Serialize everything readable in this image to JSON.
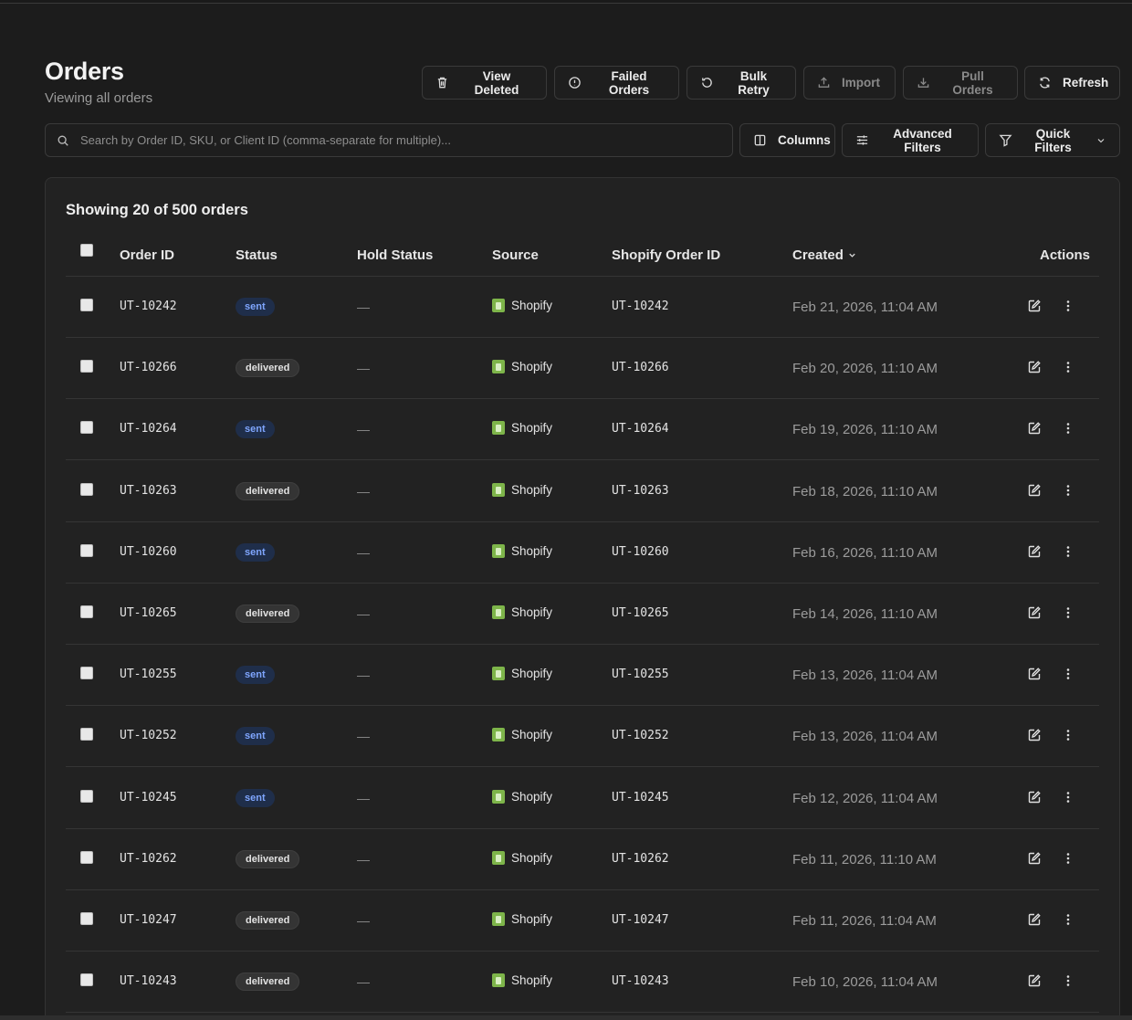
{
  "page": {
    "title": "Orders",
    "subtitle": "Viewing all orders"
  },
  "toolbar": {
    "view_deleted": "View Deleted",
    "failed_orders": "Failed Orders",
    "bulk_retry": "Bulk Retry",
    "import": "Import",
    "pull_orders": "Pull Orders",
    "refresh": "Refresh"
  },
  "search": {
    "placeholder": "Search by Order ID, SKU, or Client ID (comma-separate for multiple)...",
    "value": ""
  },
  "filters": {
    "columns": "Columns",
    "advanced_filters": "Advanced Filters",
    "quick_filters": "Quick Filters"
  },
  "table": {
    "showing": "Showing 20 of 500 orders",
    "headers": {
      "order_id": "Order ID",
      "status": "Status",
      "hold_status": "Hold Status",
      "source": "Source",
      "shopify_order_id": "Shopify Order ID",
      "created": "Created",
      "actions": "Actions"
    },
    "rows": [
      {
        "order_id": "UT-10242",
        "status": "sent",
        "hold": "—",
        "source": "Shopify",
        "shopify_id": "UT-10242",
        "created": "Feb 21, 2026, 11:04 AM"
      },
      {
        "order_id": "UT-10266",
        "status": "delivered",
        "hold": "—",
        "source": "Shopify",
        "shopify_id": "UT-10266",
        "created": "Feb 20, 2026, 11:10 AM"
      },
      {
        "order_id": "UT-10264",
        "status": "sent",
        "hold": "—",
        "source": "Shopify",
        "shopify_id": "UT-10264",
        "created": "Feb 19, 2026, 11:10 AM"
      },
      {
        "order_id": "UT-10263",
        "status": "delivered",
        "hold": "—",
        "source": "Shopify",
        "shopify_id": "UT-10263",
        "created": "Feb 18, 2026, 11:10 AM"
      },
      {
        "order_id": "UT-10260",
        "status": "sent",
        "hold": "—",
        "source": "Shopify",
        "shopify_id": "UT-10260",
        "created": "Feb 16, 2026, 11:10 AM"
      },
      {
        "order_id": "UT-10265",
        "status": "delivered",
        "hold": "—",
        "source": "Shopify",
        "shopify_id": "UT-10265",
        "created": "Feb 14, 2026, 11:10 AM"
      },
      {
        "order_id": "UT-10255",
        "status": "sent",
        "hold": "—",
        "source": "Shopify",
        "shopify_id": "UT-10255",
        "created": "Feb 13, 2026, 11:04 AM"
      },
      {
        "order_id": "UT-10252",
        "status": "sent",
        "hold": "—",
        "source": "Shopify",
        "shopify_id": "UT-10252",
        "created": "Feb 13, 2026, 11:04 AM"
      },
      {
        "order_id": "UT-10245",
        "status": "sent",
        "hold": "—",
        "source": "Shopify",
        "shopify_id": "UT-10245",
        "created": "Feb 12, 2026, 11:04 AM"
      },
      {
        "order_id": "UT-10262",
        "status": "delivered",
        "hold": "—",
        "source": "Shopify",
        "shopify_id": "UT-10262",
        "created": "Feb 11, 2026, 11:10 AM"
      },
      {
        "order_id": "UT-10247",
        "status": "delivered",
        "hold": "—",
        "source": "Shopify",
        "shopify_id": "UT-10247",
        "created": "Feb 11, 2026, 11:04 AM"
      },
      {
        "order_id": "UT-10243",
        "status": "delivered",
        "hold": "—",
        "source": "Shopify",
        "shopify_id": "UT-10243",
        "created": "Feb 10, 2026, 11:04 AM"
      }
    ]
  },
  "colors": {
    "background": "#1c1c1c",
    "panel": "#222222",
    "sent_badge_text": "#7fa6ff",
    "shopify_green": "#7eb54a"
  }
}
